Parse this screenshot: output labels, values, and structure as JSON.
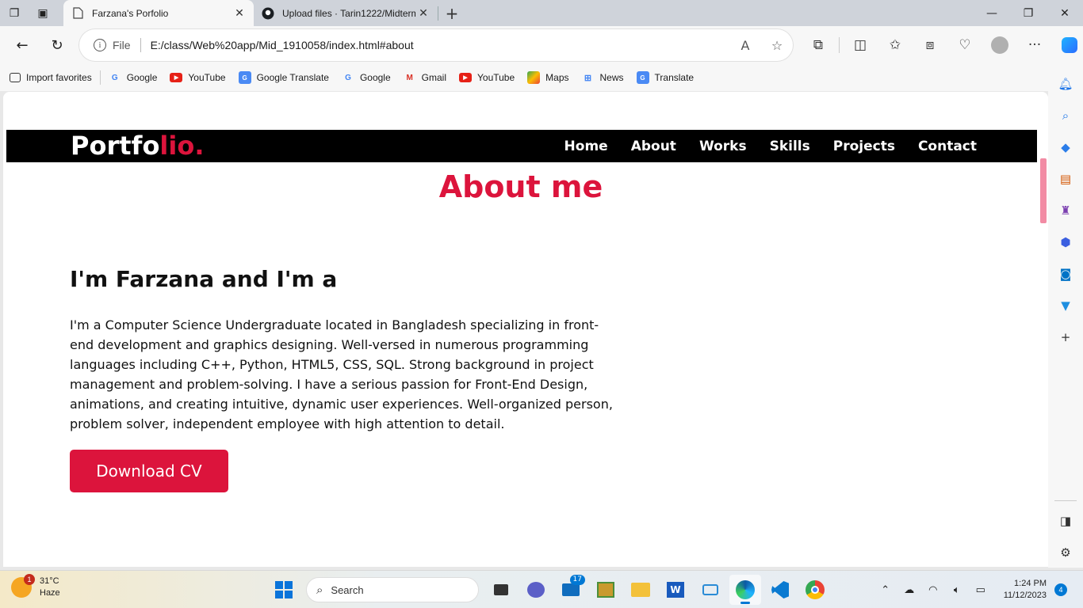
{
  "browser": {
    "tabs": [
      {
        "title": "Farzana's Porfolio",
        "active": true
      },
      {
        "title": "Upload files · Tarin1222/Midterm",
        "active": false
      }
    ],
    "address": {
      "scheme_label": "File",
      "url": "E:/class/Web%20app/Mid_1910058/index.html#about"
    },
    "favorites": [
      {
        "label": "Import favorites",
        "icon": "import-icon"
      },
      {
        "label": "Google",
        "icon": "google-icon"
      },
      {
        "label": "YouTube",
        "icon": "youtube-icon"
      },
      {
        "label": "Google Translate",
        "icon": "translate-icon"
      },
      {
        "label": "Google",
        "icon": "google-icon"
      },
      {
        "label": "Gmail",
        "icon": "gmail-icon"
      },
      {
        "label": "YouTube",
        "icon": "youtube-icon"
      },
      {
        "label": "Maps",
        "icon": "maps-icon"
      },
      {
        "label": "News",
        "icon": "news-icon"
      },
      {
        "label": "Translate",
        "icon": "translate-icon"
      }
    ]
  },
  "site": {
    "logo_main": "Portfo",
    "logo_accent": "lio.",
    "nav": [
      "Home",
      "About",
      "Works",
      "Skills",
      "Projects",
      "Contact"
    ],
    "about": {
      "title": "About me",
      "heading": "I'm Farzana and I'm a",
      "text": "I'm a Computer Science Undergraduate located in Bangladesh specializing in front-end development and graphics designing. Well-versed in numerous programming languages including C++, Python, HTML5, CSS, SQL. Strong background in project management and problem-solving. I have a serious passion for Front-End Design, animations, and creating intuitive, dynamic user experiences. Well-organized person, problem solver, independent employee with high attention to detail.",
      "button": "Download CV"
    },
    "accent_color": "#dc143c"
  },
  "taskbar": {
    "weather": {
      "temp": "31°C",
      "condition": "Haze",
      "alert_count": "1"
    },
    "search_placeholder": "Search",
    "mail_badge": "17",
    "time": "1:24 PM",
    "date": "11/12/2023",
    "notification_count": "4"
  }
}
